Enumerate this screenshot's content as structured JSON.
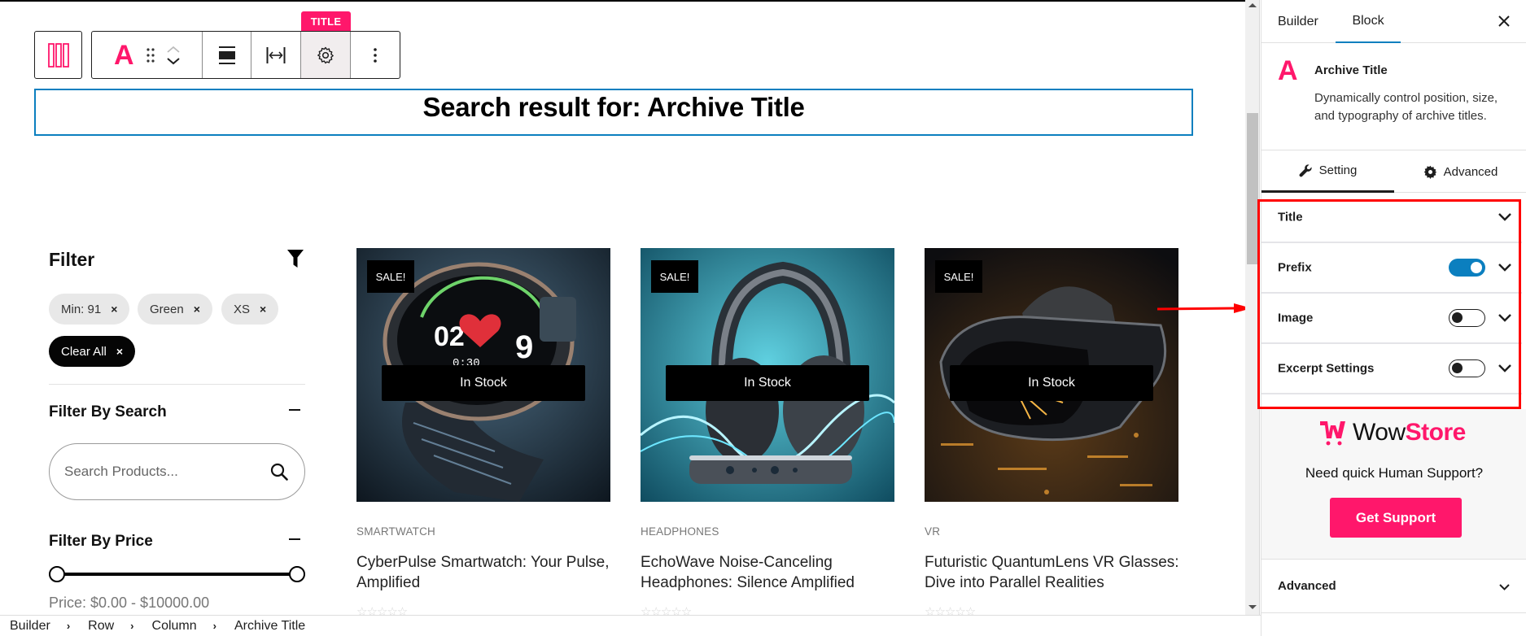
{
  "toolbar": {
    "block_label_tag": "TITLE",
    "buttons": [
      "parent-block",
      "block-type",
      "drag",
      "move-up-down",
      "align",
      "width",
      "settings",
      "more-options"
    ]
  },
  "archive_title": "Search result for: Archive Title",
  "filter": {
    "title": "Filter",
    "active_chips": [
      {
        "label": "Min: 91",
        "remove": "×"
      },
      {
        "label": "Green",
        "remove": "×"
      },
      {
        "label": "XS",
        "remove": "×"
      }
    ],
    "clear_all": {
      "label": "Clear All",
      "remove": "×"
    },
    "search": {
      "heading": "Filter By Search",
      "placeholder": "Search Products...",
      "value": ""
    },
    "price": {
      "heading": "Filter By Price",
      "min": 0,
      "max": 10000,
      "range_min_fraction": 0,
      "range_max_fraction": 1,
      "label": "Price: $0.00 - $10000.00"
    }
  },
  "products": [
    {
      "badge": "SALE!",
      "stock": "In Stock",
      "category": "SMARTWATCH",
      "title": "CyberPulse Smartwatch: Your Pulse, Amplified",
      "rating": 0,
      "stars": "☆☆☆☆☆",
      "image": "smartwatch-image"
    },
    {
      "badge": "SALE!",
      "stock": "In Stock",
      "category": "HEADPHONES",
      "title": "EchoWave Noise-Canceling Headphones: Silence Amplified",
      "rating": 0,
      "stars": "☆☆☆☆☆",
      "image": "headphones-image"
    },
    {
      "badge": "SALE!",
      "stock": "In Stock",
      "category": "VR",
      "title": "Futuristic QuantumLens VR Glasses: Dive into Parallel Realities",
      "rating": 0,
      "stars": "☆☆☆☆☆",
      "image": "vr-glasses-image"
    }
  ],
  "breadcrumb": {
    "items": [
      "Builder",
      "Row",
      "Column",
      "Archive Title"
    ],
    "separator": "›"
  },
  "panel": {
    "tabs": {
      "builder": "Builder",
      "block": "Block",
      "active": "Block"
    },
    "block": {
      "icon_letter": "A",
      "name": "Archive Title",
      "description": "Dynamically control position, size, and typography of archive titles."
    },
    "setting_tabs": {
      "setting": "Setting",
      "advanced": "Advanced",
      "active": "Setting"
    },
    "sections": [
      {
        "label": "Title",
        "toggle": null
      },
      {
        "label": "Prefix",
        "toggle": true
      },
      {
        "label": "Image",
        "toggle": false
      },
      {
        "label": "Excerpt Settings",
        "toggle": false
      }
    ],
    "support": {
      "brand_prefix": "Wow",
      "brand_suffix": "Store",
      "text": "Need quick Human Support?",
      "button": "Get Support"
    },
    "advanced_section": "Advanced"
  },
  "colors": {
    "brand_pink": "#ff176b",
    "selection_blue": "#0b7fbf",
    "annotation_red": "#ff0000"
  }
}
